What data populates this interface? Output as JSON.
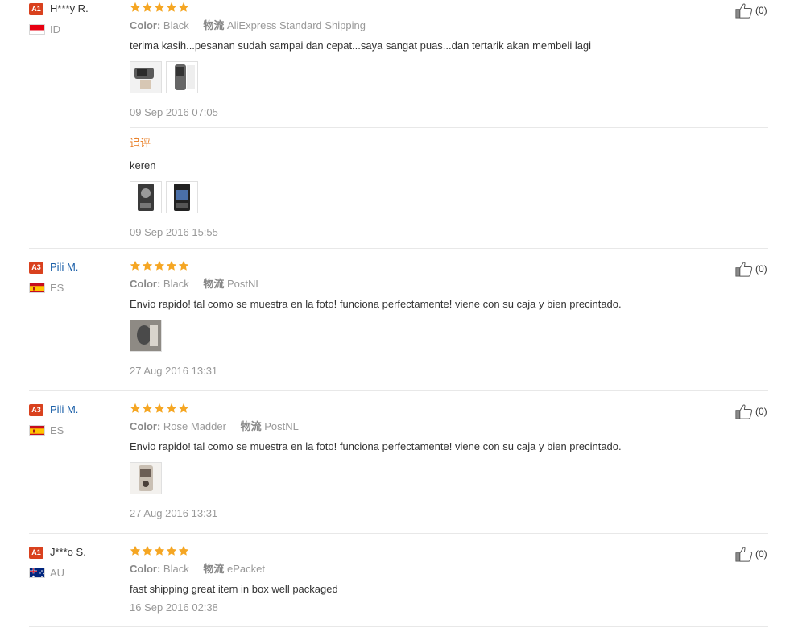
{
  "icons": {
    "star": "star-icon",
    "thumbs_up": "thumbs-up-icon",
    "photo": "photo-icon",
    "flag_id": "flag-indonesia",
    "flag_es": "flag-spain",
    "flag_au": "flag-australia"
  },
  "colors": {
    "star": "#f5a623",
    "level_badge": "#d9411e",
    "name_link": "#1a5fa8",
    "additional_label": "#e8791c"
  },
  "reviews": [
    {
      "level": "A1",
      "user": "H***y R.",
      "country": "ID",
      "rating": 5,
      "color_label": "Color:",
      "color_value": "Black",
      "shipping_label": "物流",
      "shipping_value": "AliExpress Standard Shipping",
      "text": "terima kasih...pesanan sudah sampai dan cepat...saya sangat puas...dan tertarik akan membeli lagi",
      "date": "09 Sep 2016 07:05",
      "helpful": "(0)",
      "additional": {
        "label": "追评",
        "text": "keren",
        "date": "09 Sep 2016 15:55"
      }
    },
    {
      "level": "A3",
      "user": "Pili M.",
      "country": "ES",
      "rating": 5,
      "color_label": "Color:",
      "color_value": "Black",
      "shipping_label": "物流",
      "shipping_value": "PostNL",
      "text": "Envio rapido! tal como se muestra en la foto! funciona perfectamente! viene con su caja y bien precintado.",
      "date": "27 Aug 2016 13:31",
      "helpful": "(0)"
    },
    {
      "level": "A3",
      "user": "Pili M.",
      "country": "ES",
      "rating": 5,
      "color_label": "Color:",
      "color_value": "Rose Madder",
      "shipping_label": "物流",
      "shipping_value": "PostNL",
      "text": "Envio rapido! tal como se muestra en la foto! funciona perfectamente! viene con su caja y bien precintado.",
      "date": "27 Aug 2016 13:31",
      "helpful": "(0)"
    },
    {
      "level": "A1",
      "user": "J***o S.",
      "country": "AU",
      "rating": 5,
      "color_label": "Color:",
      "color_value": "Black",
      "shipping_label": "物流",
      "shipping_value": "ePacket",
      "text": "fast shipping great item in box well packaged",
      "date": "16 Sep 2016 02:38",
      "helpful": "(0)"
    }
  ]
}
